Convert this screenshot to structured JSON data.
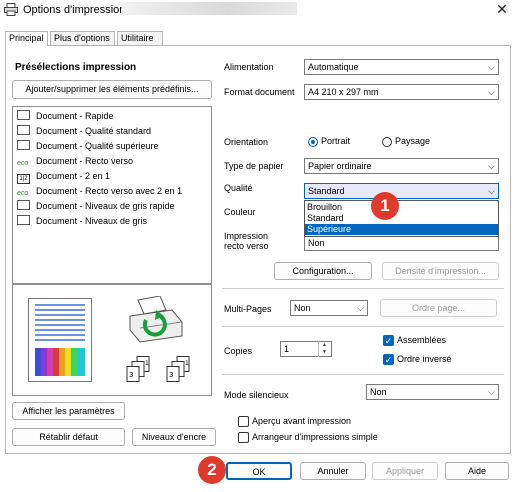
{
  "window": {
    "title": "Options d'impression",
    "close_glyph": "✕"
  },
  "tabs": [
    {
      "label": "Principal"
    },
    {
      "label": "Plus d'options"
    },
    {
      "label": "Utilitaire"
    }
  ],
  "presets": {
    "heading": "Présélections impression",
    "add_remove_button": "Ajouter/supprimer les éléments prédéfinis...",
    "items": [
      {
        "label": "Document - Rapide",
        "icon": "document-icon"
      },
      {
        "label": "Document - Qualité standard",
        "icon": "document-icon"
      },
      {
        "label": "Document - Qualité supérieure",
        "icon": "document-icon"
      },
      {
        "label": "Document - Recto verso",
        "icon": "eco-icon"
      },
      {
        "label": "Document - 2 en 1",
        "icon": "two-up-icon"
      },
      {
        "label": "Document - Recto verso avec 2 en 1",
        "icon": "eco-icon"
      },
      {
        "label": "Document - Niveaux de gris rapide",
        "icon": "document-icon"
      },
      {
        "label": "Document - Niveaux de gris",
        "icon": "document-icon"
      }
    ],
    "eco_text": "eco",
    "twoup_text": "1|2"
  },
  "left_buttons": {
    "show_settings": "Afficher les paramètres",
    "restore_default": "Rétablir défaut",
    "ink_levels": "Niveaux d'encre"
  },
  "settings": {
    "source_label": "Alimentation",
    "source_value": "Automatique",
    "doc_size_label": "Format document",
    "doc_size_value": "A4 210 x 297 mm",
    "orientation_label": "Orientation",
    "portrait_label": "Portrait",
    "landscape_label": "Paysage",
    "paper_type_label": "Type de papier",
    "paper_type_value": "Papier ordinaire",
    "quality_label": "Qualité",
    "quality_value": "Standard",
    "quality_options": [
      "Brouillon",
      "Standard",
      "Supérieure"
    ],
    "color_label": "Couleur",
    "duplex_label_1": "Impression",
    "duplex_label_2": "recto verso",
    "duplex_value": "Non",
    "config_button": "Configuration...",
    "density_button": "Densité d'impression...",
    "multipage_label": "Multi-Pages",
    "multipage_value": "Non",
    "page_order_button": "Ordre page...",
    "copies_label": "Copies",
    "copies_value": "1",
    "collate_label": "Assemblées",
    "reverse_label": "Ordre inversé",
    "quiet_label": "Mode silencieux",
    "quiet_value": "Non",
    "preview_label": "Aperçu avant impression",
    "job_arranger_label": "Arrangeur d'impressions simple"
  },
  "footer": {
    "ok": "OK",
    "cancel": "Annuler",
    "apply": "Appliquer",
    "help": "Aide"
  },
  "badges": {
    "one": "1",
    "two": "2"
  },
  "glyphs": {
    "chevron": "⌵",
    "up": "▲",
    "down": "▼",
    "check": "✓"
  },
  "colors": {
    "accent": "#0067c0",
    "badge": "#e03a2c"
  }
}
